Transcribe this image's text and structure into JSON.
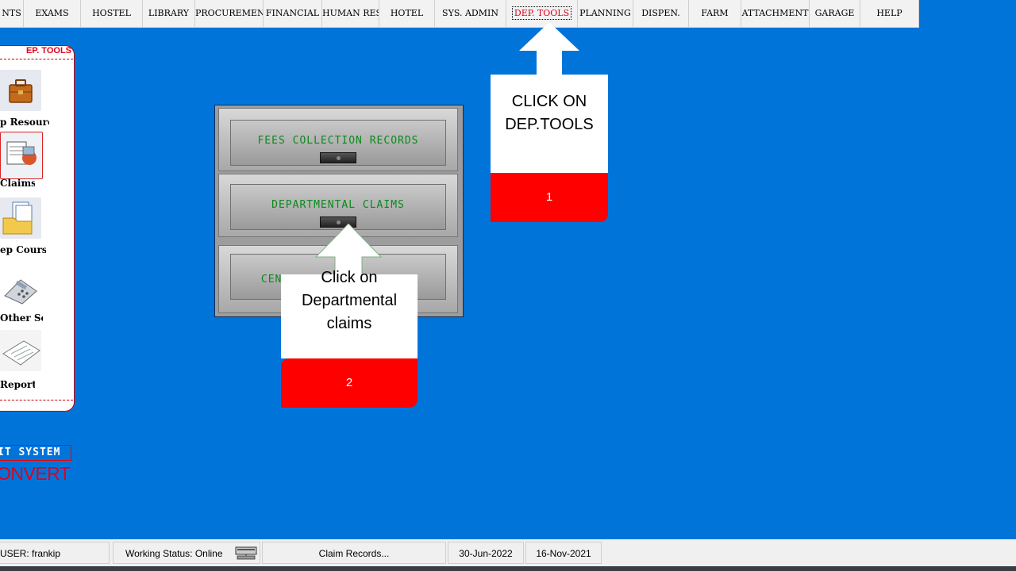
{
  "menu": {
    "items": [
      {
        "label": "NTS"
      },
      {
        "label": "EXAMS"
      },
      {
        "label": "HOSTEL"
      },
      {
        "label": "LIBRARY"
      },
      {
        "label": "PROCUREMENT"
      },
      {
        "label": "FINANCIAL"
      },
      {
        "label": "HUMAN RES"
      },
      {
        "label": "HOTEL"
      },
      {
        "label": "SYS. ADMIN"
      },
      {
        "label": "DEP. TOOLS",
        "active": true
      },
      {
        "label": "PLANNING"
      },
      {
        "label": "DISPEN."
      },
      {
        "label": "FARM"
      },
      {
        "label": "ATTACHMENT"
      },
      {
        "label": "GARAGE"
      },
      {
        "label": "HELP"
      }
    ]
  },
  "sidebar": {
    "title": "EP. TOOLS",
    "items": [
      {
        "label": "p Resources",
        "icon": "briefcase-icon"
      },
      {
        "label": "Claims",
        "icon": "claims-documents-icon"
      },
      {
        "label": "ep Courses",
        "icon": "folder-documents-icon"
      },
      {
        "label": "Other Serv",
        "icon": "calculator-icon"
      },
      {
        "label": "Reports",
        "icon": "accounts-report-icon"
      }
    ]
  },
  "cabinet": {
    "drawers": [
      {
        "label": "FEES COLLECTION RECORDS"
      },
      {
        "label": "DEPARTMENTAL CLAIMS"
      },
      {
        "label": "CENTRAL CLAIMS RECORDS"
      }
    ]
  },
  "callouts": [
    {
      "text_line1": "CLICK ON",
      "text_line2": "DEP.TOOLS",
      "number": "1"
    },
    {
      "text_line1": "Click on",
      "text_line2": "Departmental",
      "text_line3": "claims",
      "number": "2"
    }
  ],
  "branding": {
    "system_text": "IT SYSTEM",
    "convert_text": "ONVERT"
  },
  "status": {
    "user": "USER: frankip",
    "working_status": "Working Status: Online",
    "task": "Claim Records...",
    "date1": "30-Jun-2022",
    "date2": "16-Nov-2021"
  },
  "colors": {
    "background": "#0074d9",
    "active_menu": "#e0001b",
    "callout_number_bg": "#ff0000",
    "drawer_label": "#0a8a1a"
  }
}
